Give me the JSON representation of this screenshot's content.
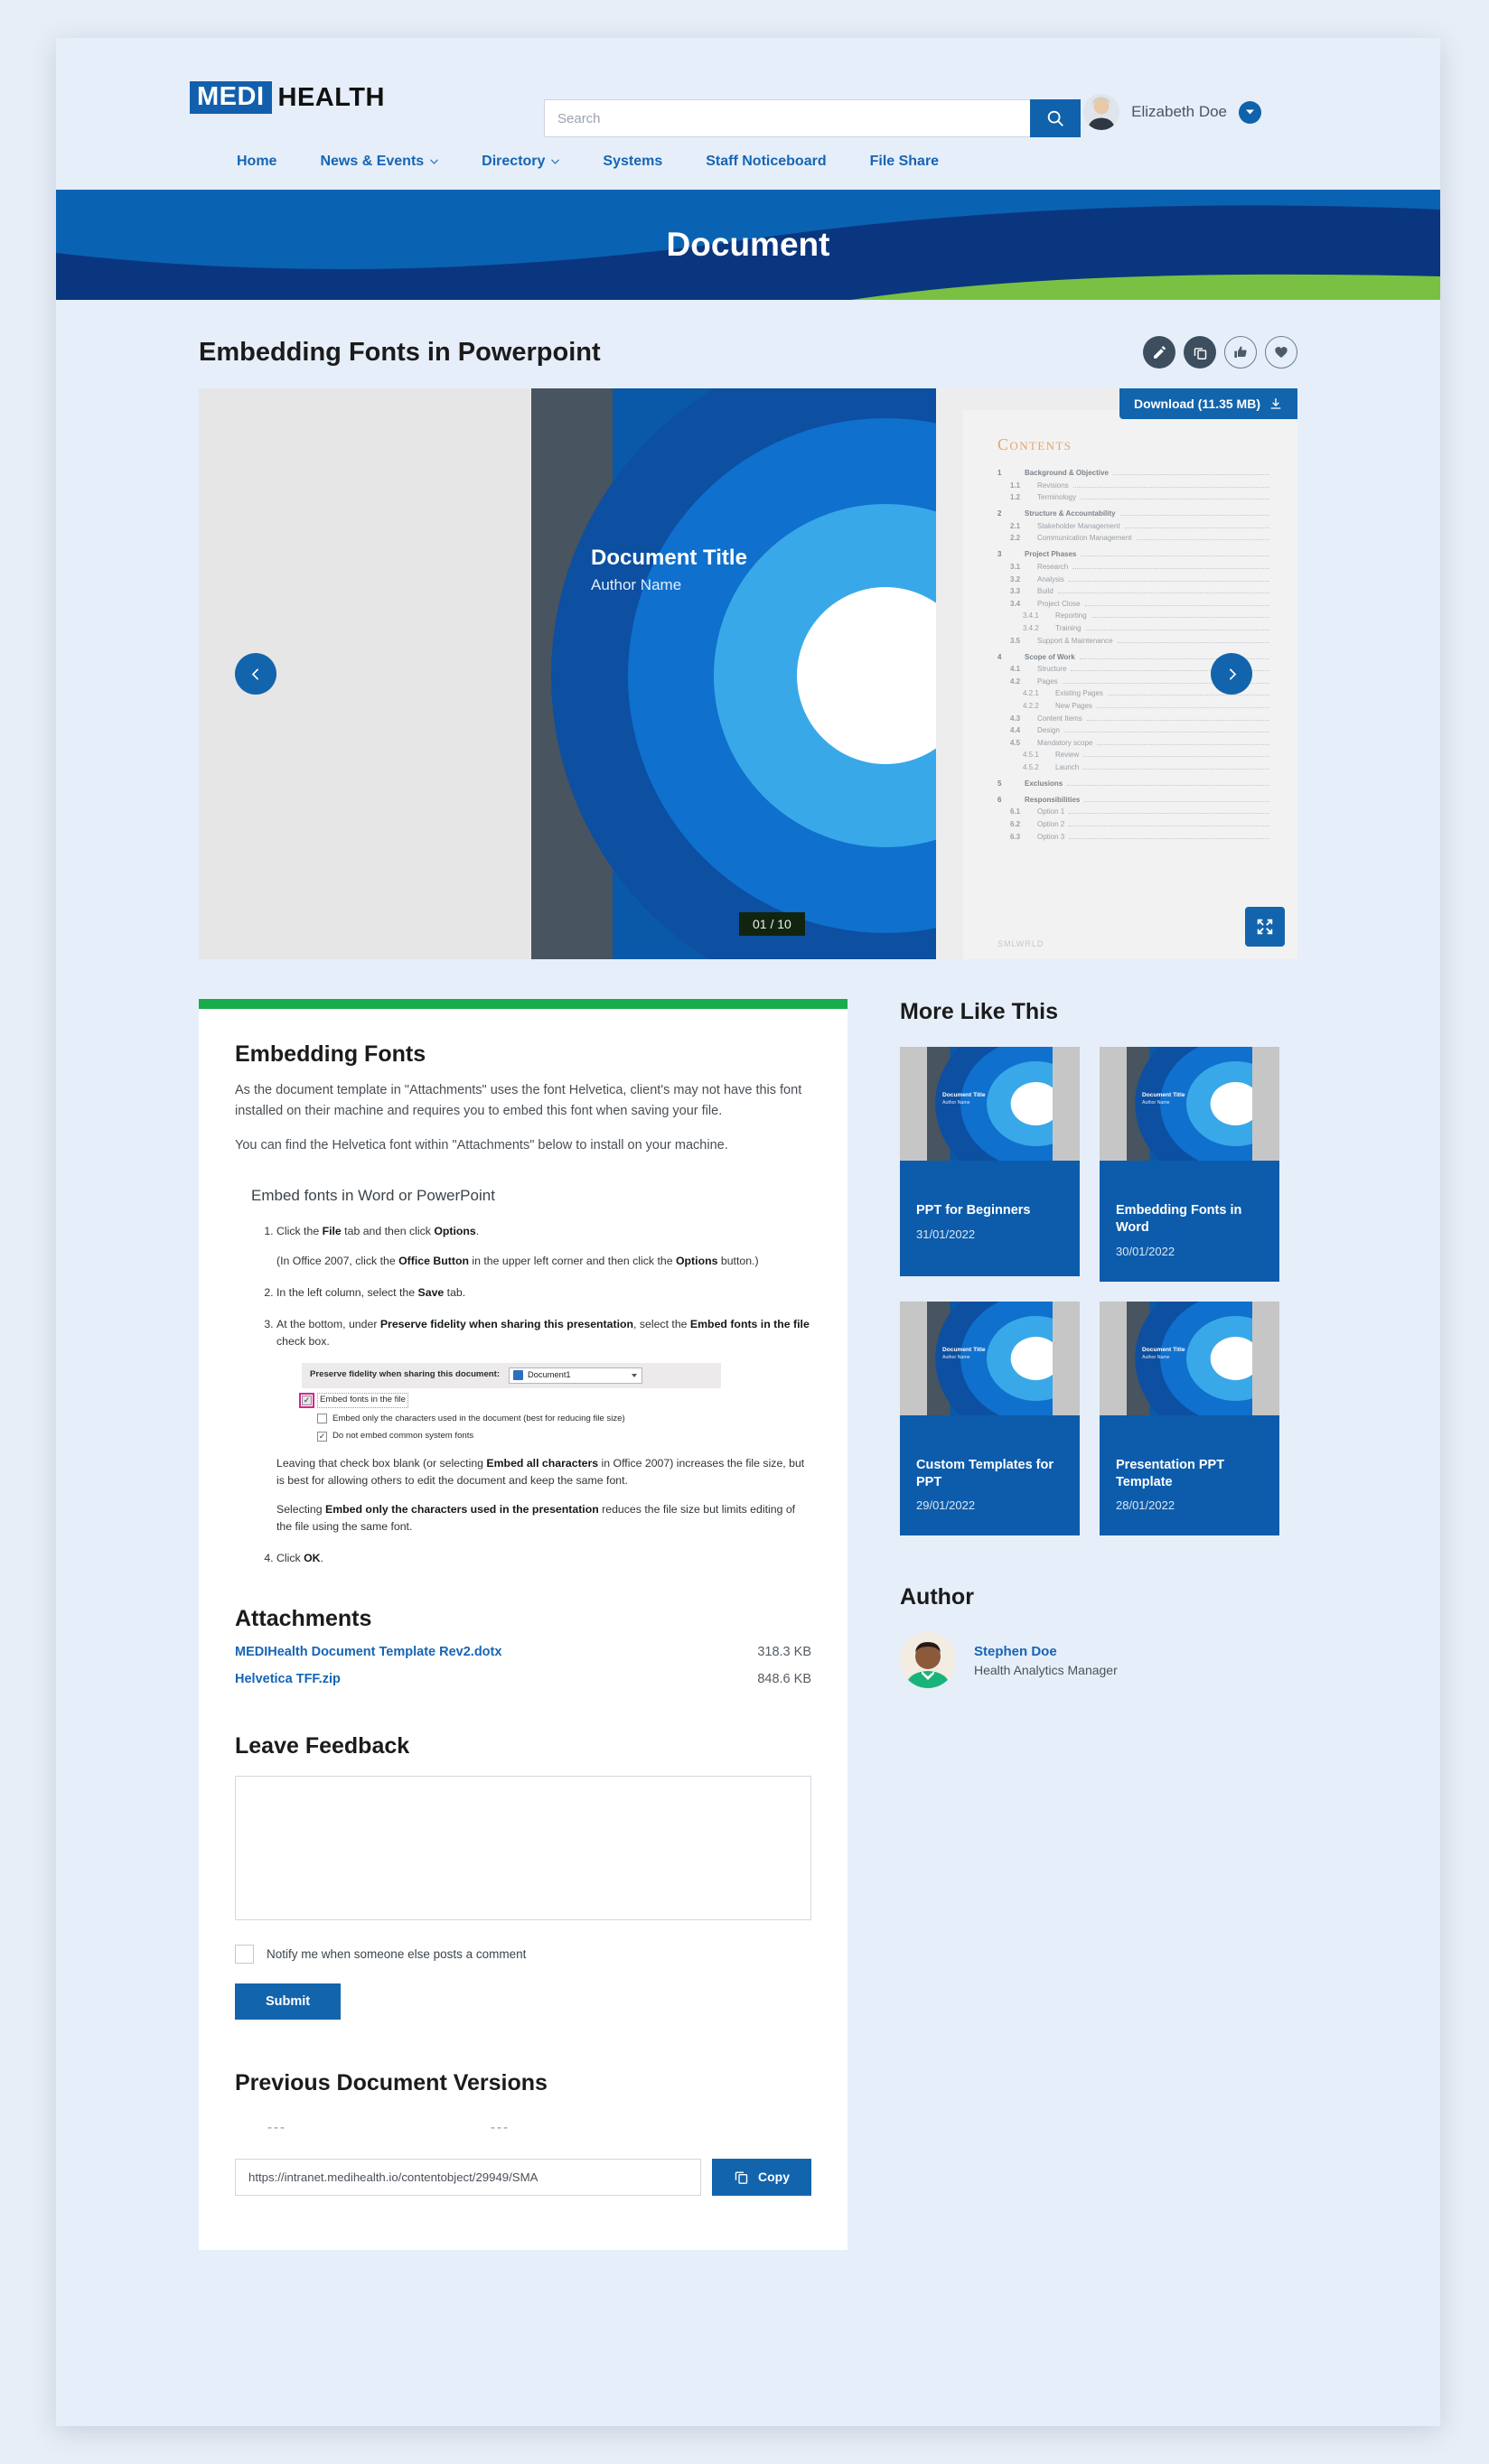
{
  "header": {
    "logo_primary": "MEDI",
    "logo_secondary": "HEALTH",
    "search_placeholder": "Search",
    "search_value": "",
    "user_name": "Elizabeth Doe",
    "nav_items": [
      {
        "label": "Home",
        "has_caret": false
      },
      {
        "label": "News & Events",
        "has_caret": true
      },
      {
        "label": "Directory",
        "has_caret": true
      },
      {
        "label": "Systems",
        "has_caret": false
      },
      {
        "label": "Staff Noticeboard",
        "has_caret": false
      },
      {
        "label": "File Share",
        "has_caret": false
      }
    ]
  },
  "hero": {
    "title": "Document"
  },
  "document": {
    "title": "Embedding Fonts in Powerpoint",
    "actions": [
      "edit-icon",
      "copy-icon",
      "thumbs-up-icon",
      "heart-icon"
    ],
    "download_label": "Download (11.35 MB)",
    "page_counter": "01 / 10",
    "slide": {
      "title": "Document Title",
      "author": "Author Name"
    },
    "toc": {
      "heading": "Contents",
      "footer": "SMLWRLD",
      "entries": [
        {
          "num": "1",
          "label": "Background & Objective",
          "level": 1
        },
        {
          "num": "1.1",
          "label": "Revisions",
          "level": 2
        },
        {
          "num": "1.2",
          "label": "Terminology",
          "level": 2
        },
        {
          "num": "2",
          "label": "Structure & Accountability",
          "level": 1
        },
        {
          "num": "2.1",
          "label": "Stakeholder Management",
          "level": 2
        },
        {
          "num": "2.2",
          "label": "Communication Management",
          "level": 2
        },
        {
          "num": "3",
          "label": "Project Phases",
          "level": 1
        },
        {
          "num": "3.1",
          "label": "Research",
          "level": 2
        },
        {
          "num": "3.2",
          "label": "Analysis",
          "level": 2
        },
        {
          "num": "3.3",
          "label": "Build",
          "level": 2
        },
        {
          "num": "3.4",
          "label": "Project Close",
          "level": 2
        },
        {
          "num": "3.4.1",
          "label": "Reporting",
          "level": 3
        },
        {
          "num": "3.4.2",
          "label": "Training",
          "level": 3
        },
        {
          "num": "3.5",
          "label": "Support & Maintenance",
          "level": 2
        },
        {
          "num": "4",
          "label": "Scope of Work",
          "level": 1
        },
        {
          "num": "4.1",
          "label": "Structure",
          "level": 2
        },
        {
          "num": "4.2",
          "label": "Pages",
          "level": 2
        },
        {
          "num": "4.2.1",
          "label": "Existing Pages",
          "level": 3
        },
        {
          "num": "4.2.2",
          "label": "New Pages",
          "level": 3
        },
        {
          "num": "4.3",
          "label": "Content Items",
          "level": 2
        },
        {
          "num": "4.4",
          "label": "Design",
          "level": 2
        },
        {
          "num": "4.5",
          "label": "Mandatory scope",
          "level": 2
        },
        {
          "num": "4.5.1",
          "label": "Review",
          "level": 3
        },
        {
          "num": "4.5.2",
          "label": "Launch",
          "level": 3
        },
        {
          "num": "5",
          "label": "Exclusions",
          "level": 1
        },
        {
          "num": "6",
          "label": "Responsibilities",
          "level": 1
        },
        {
          "num": "6.1",
          "label": "Option 1",
          "level": 2
        },
        {
          "num": "6.2",
          "label": "Option 2",
          "level": 2
        },
        {
          "num": "6.3",
          "label": "Option 3",
          "level": 2
        }
      ]
    }
  },
  "article": {
    "heading": "Embedding Fonts",
    "para1": "As the document template in \"Attachments\" uses the font Helvetica, client's may not have this font installed on their machine and requires you to embed this font when saving your file.",
    "para2": "You can find the Helvetica font within \"Attachments\" below to install on your machine.",
    "subheading": "Embed fonts in Word or PowerPoint",
    "step1_a": "Click the ",
    "step1_b": "File",
    "step1_c": " tab and then click ",
    "step1_d": "Options",
    "step1_e": ".",
    "step1_note_a": "(In Office 2007, click the ",
    "step1_note_b": "Office Button",
    "step1_note_c": " in the upper left corner and then click the ",
    "step1_note_d": "Options",
    "step1_note_e": " button.)",
    "step2_a": "In the left column, select the ",
    "step2_b": "Save",
    "step2_c": " tab.",
    "step3_a": "At the bottom, under ",
    "step3_b": "Preserve fidelity when sharing this presentation",
    "step3_c": ", select the ",
    "step3_d": "Embed fonts in the file",
    "step3_e": " check box.",
    "step4_a": "Click ",
    "step4_b": "OK",
    "step4_c": ".",
    "dialog": {
      "label": "Preserve fidelity when sharing this document:",
      "select_value": "Document1",
      "check1": "Embed fonts in the file",
      "check2": "Embed only the characters used in the document (best for reducing file size)",
      "check3": "Do not embed common system fonts"
    },
    "note1_a": "Leaving that check box blank (or selecting ",
    "note1_b": "Embed all characters",
    "note1_c": " in Office 2007) increases the file size, but is best for allowing others to edit the document and keep the same font.",
    "note2_a": "Selecting ",
    "note2_b": "Embed only the characters used in the presentation",
    "note2_c": " reduces the file size but limits editing of the file using the same font."
  },
  "attachments": {
    "heading": "Attachments",
    "files": [
      {
        "name": "MEDIHealth Document Template Rev2.dotx",
        "size": "318.3 KB"
      },
      {
        "name": "Helvetica TFF.zip",
        "size": "848.6 KB"
      }
    ]
  },
  "feedback": {
    "heading": "Leave Feedback",
    "textarea_value": "",
    "textarea_placeholder": "",
    "notify_label": "Notify me when someone else posts a comment",
    "submit_label": "Submit"
  },
  "versions": {
    "heading": "Previous Document Versions",
    "placeholder_left": "---",
    "placeholder_right": "---",
    "url_value": "https://intranet.medihealth.io/contentobject/29949/SMA",
    "copy_label": "Copy"
  },
  "more_like_this": {
    "heading": "More Like This",
    "thumb_title": "Document Title",
    "thumb_author": "Author Name",
    "cards": [
      {
        "title": "PPT for Beginners",
        "date": "31/01/2022"
      },
      {
        "title": "Embedding Fonts in Word",
        "date": "30/01/2022"
      },
      {
        "title": "Custom Templates for PPT",
        "date": "29/01/2022"
      },
      {
        "title": "Presentation PPT Template",
        "date": "28/01/2022"
      }
    ]
  },
  "author": {
    "heading": "Author",
    "name": "Stephen Doe",
    "role": "Health Analytics Manager"
  },
  "colors": {
    "brand_blue": "#1264ad",
    "deep_blue": "#0a3d8f",
    "accent_green": "#19ac4b",
    "hero_green": "#7ac143",
    "link_blue": "#1565b5"
  }
}
